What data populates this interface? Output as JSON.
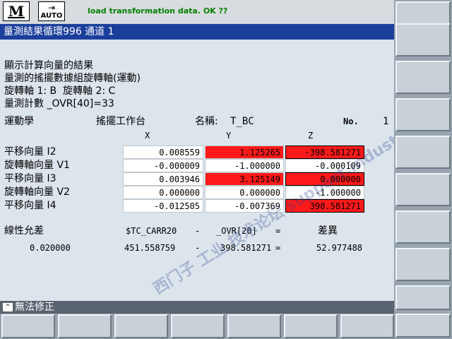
{
  "topbar": {
    "mode_icon_label": "M",
    "auto_label": "AUTO",
    "auto_icon_arrow": "⇥",
    "message": "load transformation data. OK ??"
  },
  "title": "量測結果循環996 通道 1",
  "info": {
    "line1": "顯示計算向量的結果",
    "line2": "量測的搖擺數據組旋轉軸(運動)",
    "line3": "旋轉軸 1: B  旋轉軸 2: C",
    "line4": "量測計數 _OVR[40]=33"
  },
  "header": {
    "kinematics": "運動學",
    "swivel": "搖擺工作台",
    "name_label": "名稱:",
    "name_value": "T_BC",
    "no_label": "No.",
    "no_value": "1",
    "col_x": "X",
    "col_y": "Y",
    "col_z": "Z"
  },
  "table": {
    "rows": [
      {
        "label": "平移向量 I2",
        "x": "0.008559",
        "y": "1.125265",
        "z": "-398.581271",
        "x_hl": false,
        "y_hl": true,
        "z_hl": true
      },
      {
        "label": "旋轉軸向量 V1",
        "x": "-0.000009",
        "y": "-1.000000",
        "z": "-0.000109",
        "x_hl": false,
        "y_hl": false,
        "z_hl": false
      },
      {
        "label": "平移向量 I3",
        "x": "0.003946",
        "y": "3.125149",
        "z": "0.000000",
        "x_hl": false,
        "y_hl": true,
        "z_hl": true
      },
      {
        "label": "旋轉軸向量 V2",
        "x": "0.000000",
        "y": "0.000000",
        "z": "-1.000000",
        "x_hl": false,
        "y_hl": false,
        "z_hl": false
      },
      {
        "label": "平移向量 I4",
        "x": "-0.012505",
        "y": "-0.007369",
        "z": "398.581271",
        "x_hl": false,
        "y_hl": false,
        "z_hl": true
      }
    ]
  },
  "tolerance": {
    "label": "線性允差",
    "value": "0.020000",
    "tc_label": "$TC_CARR20",
    "tc_value": "451.558759",
    "minus1": "-",
    "minus2": "-",
    "ovr_label": "_OVR[20]",
    "ovr_value": "398.581271",
    "eq1": "=",
    "eq2": "=",
    "diff_label": "差異",
    "diff_value": "52.977488"
  },
  "bottom": {
    "arrow": "^",
    "text": "無法修正"
  },
  "watermark": "西门子 工业 技术论坛 support.industry.siemens.com/cs"
}
